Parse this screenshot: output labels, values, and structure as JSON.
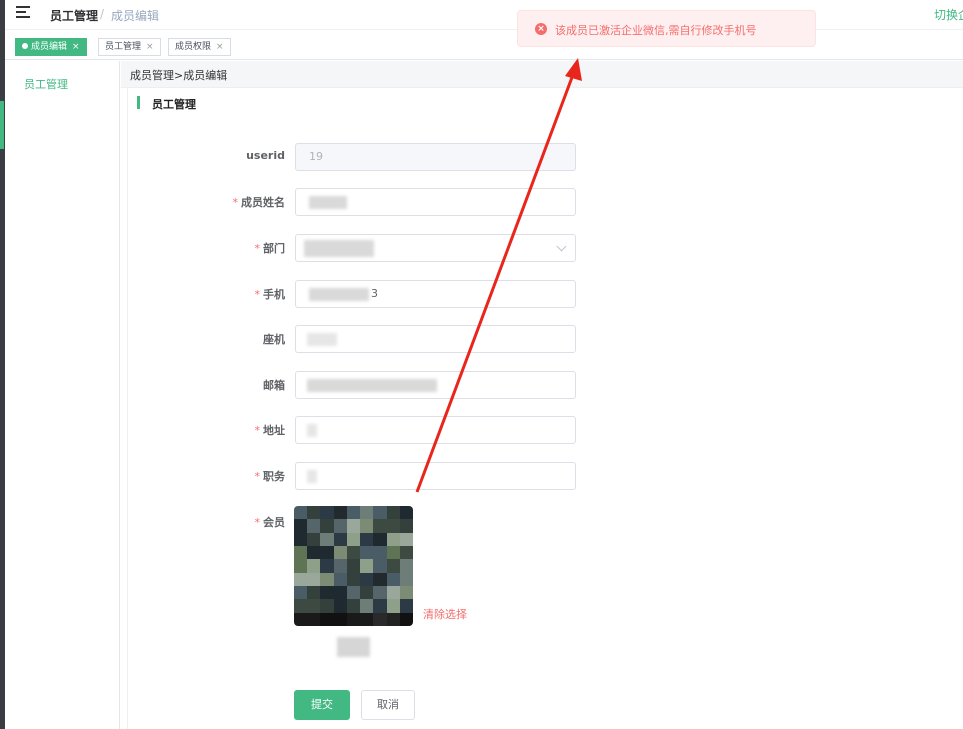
{
  "header": {
    "breadcrumb_main": "员工管理",
    "breadcrumb_separator": "/",
    "breadcrumb_current": "成员编辑",
    "switch_label": "切换企"
  },
  "tabs": [
    {
      "label": "成员编辑",
      "active": true
    },
    {
      "label": "员工管理",
      "active": false
    },
    {
      "label": "成员权限",
      "active": false
    }
  ],
  "tab_close": "×",
  "sidebar": {
    "items": [
      {
        "label": "员工管理"
      }
    ]
  },
  "page": {
    "crumb": "成员管理>成员编辑",
    "section_title": "员工管理"
  },
  "form": {
    "userid": {
      "label": "userid",
      "value": "19"
    },
    "name": {
      "label": "成员姓名",
      "required": true
    },
    "department": {
      "label": "部门",
      "required": true
    },
    "phone": {
      "label": "手机",
      "required": true,
      "visible_suffix": "3"
    },
    "landline": {
      "label": "座机",
      "required": false
    },
    "email": {
      "label": "邮箱",
      "required": false
    },
    "address": {
      "label": "地址",
      "required": true
    },
    "position": {
      "label": "职务",
      "required": true
    },
    "member": {
      "label": "会员",
      "required": true,
      "clear_label": "清除选择"
    },
    "required_mark": "*"
  },
  "buttons": {
    "submit": "提交",
    "cancel": "取消"
  },
  "toast": {
    "icon": "error-circle-icon",
    "text": "该成员已激活企业微信,需自行修改手机号",
    "color": "#f56c6c"
  },
  "colors": {
    "accent": "#42b983",
    "danger": "#f56c6c",
    "annotation_arrow": "#e8261c"
  }
}
